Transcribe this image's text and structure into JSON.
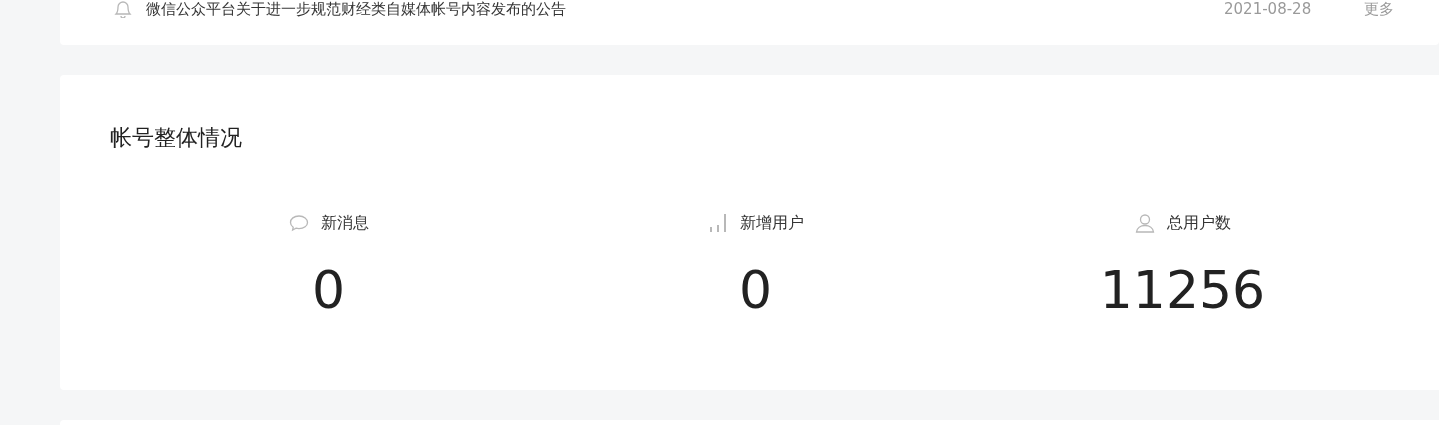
{
  "notice": {
    "title": "微信公众平台关于进一步规范财经类自媒体帐号内容发布的公告",
    "date": "2021-08-28",
    "more": "更多"
  },
  "overview": {
    "title": "帐号整体情况",
    "stats": [
      {
        "kind": "message",
        "label": "新消息",
        "value": "0"
      },
      {
        "kind": "growth",
        "label": "新增用户",
        "value": "0"
      },
      {
        "kind": "user",
        "label": "总用户数",
        "value": "11256"
      }
    ]
  }
}
